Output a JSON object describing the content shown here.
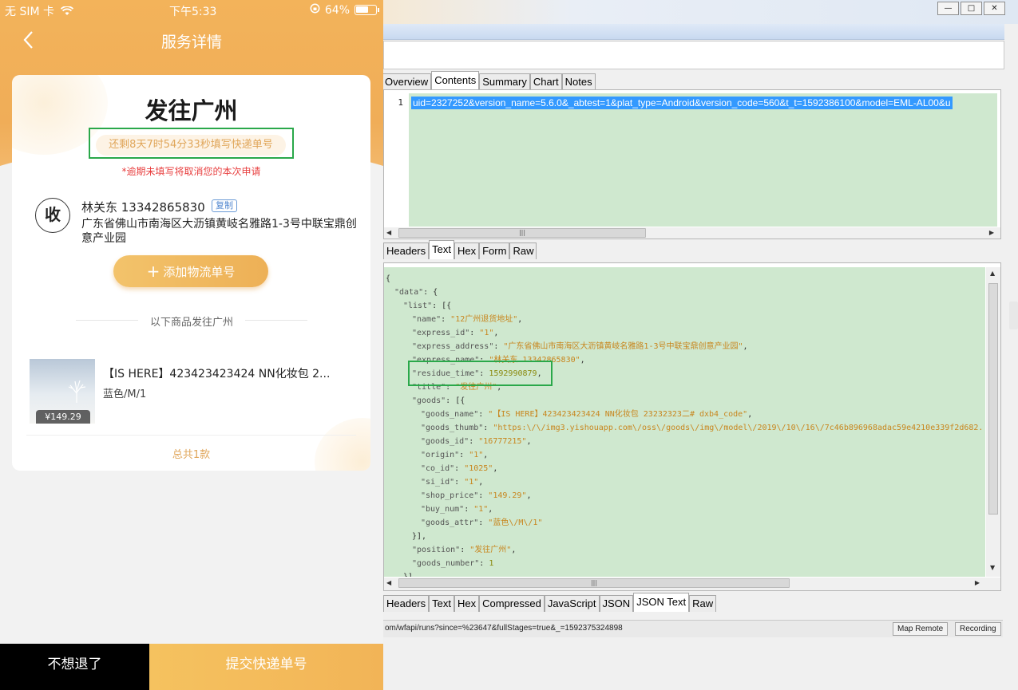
{
  "phone": {
    "status_bar": {
      "carrier": "无 SIM 卡",
      "time": "下午5:33",
      "battery": "64%",
      "battery_level": 0.64
    },
    "nav": {
      "title": "服务详情",
      "back_icon": "chevron-left-icon"
    },
    "card": {
      "destination_title": "发往广州",
      "countdown": "还剩8天7时54分33秒填写快递单号",
      "warning": "*逾期未填写将取消您的本次申请",
      "receiver_badge": "收",
      "receiver_name_phone": "林关东 13342865830",
      "copy_label": "复制",
      "receiver_address": "广东省佛山市南海区大沥镇黄岐名雅路1-3号中联宝鼎创意产业园",
      "add_tracking_label": "添加物流单号",
      "divider_text": "以下商品发往广州",
      "product": {
        "price": "¥149.29",
        "name": "【IS HERE】423423423424 NN化妆包 2...",
        "spec": "蓝色/M/1"
      },
      "total": "总共1款"
    },
    "footer": {
      "cancel_label": "不想退了",
      "submit_label": "提交快递单号"
    }
  },
  "desktop": {
    "window_controls": [
      "—",
      "□",
      "✕"
    ],
    "top_tabs": [
      "Overview",
      "Contents",
      "Summary",
      "Chart",
      "Notes"
    ],
    "active_top_tab": "Contents",
    "request_line_number": "1",
    "request_text": "uid=2327252&version_name=5.6.0&_abtest=1&plat_type=Android&version_code=560&t_t=1592386100&model=EML-AL00&u",
    "request_tabs": [
      "Headers",
      "Text",
      "Hex",
      "Form",
      "Raw"
    ],
    "active_request_tab": "Text",
    "response_tabs": [
      "Headers",
      "Text",
      "Hex",
      "Compressed",
      "JavaScript",
      "JSON",
      "JSON Text",
      "Raw"
    ],
    "active_response_tab": "JSON Text",
    "json_lines": [
      {
        "indent": 0,
        "parts": [
          {
            "t": "{",
            "c": "p"
          }
        ]
      },
      {
        "indent": 1,
        "parts": [
          {
            "t": "\"data\"",
            "c": "k"
          },
          {
            "t": ": {",
            "c": "p"
          }
        ]
      },
      {
        "indent": 2,
        "parts": [
          {
            "t": "\"list\"",
            "c": "k"
          },
          {
            "t": ": [{",
            "c": "p"
          }
        ]
      },
      {
        "indent": 3,
        "parts": [
          {
            "t": "\"name\"",
            "c": "k"
          },
          {
            "t": ": ",
            "c": "p"
          },
          {
            "t": "\"12广州退货地址\"",
            "c": "s"
          },
          {
            "t": ",",
            "c": "p"
          }
        ]
      },
      {
        "indent": 3,
        "parts": [
          {
            "t": "\"express_id\"",
            "c": "k"
          },
          {
            "t": ": ",
            "c": "p"
          },
          {
            "t": "\"1\"",
            "c": "s"
          },
          {
            "t": ",",
            "c": "p"
          }
        ]
      },
      {
        "indent": 3,
        "parts": [
          {
            "t": "\"express_address\"",
            "c": "k"
          },
          {
            "t": ": ",
            "c": "p"
          },
          {
            "t": "\"广东省佛山市南海区大沥镇黄岐名雅路1-3号中联宝鼎创意产业园\"",
            "c": "s"
          },
          {
            "t": ",",
            "c": "p"
          }
        ]
      },
      {
        "indent": 3,
        "parts": [
          {
            "t": "\"express_name\"",
            "c": "k"
          },
          {
            "t": ": ",
            "c": "p"
          },
          {
            "t": "\"林关东 13342865830\"",
            "c": "s"
          },
          {
            "t": ",",
            "c": "p"
          }
        ]
      },
      {
        "indent": 3,
        "parts": [
          {
            "t": "\"residue_time\"",
            "c": "k"
          },
          {
            "t": ": ",
            "c": "p"
          },
          {
            "t": "1592990879",
            "c": "n"
          },
          {
            "t": ",",
            "c": "p"
          }
        ]
      },
      {
        "indent": 3,
        "parts": [
          {
            "t": "\"title\"",
            "c": "k"
          },
          {
            "t": ": ",
            "c": "p"
          },
          {
            "t": "\"发往广州\"",
            "c": "s"
          },
          {
            "t": ",",
            "c": "p"
          }
        ]
      },
      {
        "indent": 3,
        "parts": [
          {
            "t": "\"goods\"",
            "c": "k"
          },
          {
            "t": ": [{",
            "c": "p"
          }
        ]
      },
      {
        "indent": 4,
        "parts": [
          {
            "t": "\"goods_name\"",
            "c": "k"
          },
          {
            "t": ": ",
            "c": "p"
          },
          {
            "t": "\"【IS HERE】423423423424 NN化妆包 23232323二# dxb4_code\"",
            "c": "s"
          },
          {
            "t": ",",
            "c": "p"
          }
        ]
      },
      {
        "indent": 4,
        "parts": [
          {
            "t": "\"goods_thumb\"",
            "c": "k"
          },
          {
            "t": ": ",
            "c": "p"
          },
          {
            "t": "\"https:\\/\\/img3.yishouapp.com\\/oss\\/goods\\/img\\/model\\/2019\\/10\\/16\\/7c46b896968adac59e4210e339f2d682.",
            "c": "s"
          }
        ]
      },
      {
        "indent": 4,
        "parts": [
          {
            "t": "\"goods_id\"",
            "c": "k"
          },
          {
            "t": ": ",
            "c": "p"
          },
          {
            "t": "\"16777215\"",
            "c": "s"
          },
          {
            "t": ",",
            "c": "p"
          }
        ]
      },
      {
        "indent": 4,
        "parts": [
          {
            "t": "\"origin\"",
            "c": "k"
          },
          {
            "t": ": ",
            "c": "p"
          },
          {
            "t": "\"1\"",
            "c": "s"
          },
          {
            "t": ",",
            "c": "p"
          }
        ]
      },
      {
        "indent": 4,
        "parts": [
          {
            "t": "\"co_id\"",
            "c": "k"
          },
          {
            "t": ": ",
            "c": "p"
          },
          {
            "t": "\"1025\"",
            "c": "s"
          },
          {
            "t": ",",
            "c": "p"
          }
        ]
      },
      {
        "indent": 4,
        "parts": [
          {
            "t": "\"si_id\"",
            "c": "k"
          },
          {
            "t": ": ",
            "c": "p"
          },
          {
            "t": "\"1\"",
            "c": "s"
          },
          {
            "t": ",",
            "c": "p"
          }
        ]
      },
      {
        "indent": 4,
        "parts": [
          {
            "t": "\"shop_price\"",
            "c": "k"
          },
          {
            "t": ": ",
            "c": "p"
          },
          {
            "t": "\"149.29\"",
            "c": "s"
          },
          {
            "t": ",",
            "c": "p"
          }
        ]
      },
      {
        "indent": 4,
        "parts": [
          {
            "t": "\"buy_num\"",
            "c": "k"
          },
          {
            "t": ": ",
            "c": "p"
          },
          {
            "t": "\"1\"",
            "c": "s"
          },
          {
            "t": ",",
            "c": "p"
          }
        ]
      },
      {
        "indent": 4,
        "parts": [
          {
            "t": "\"goods_attr\"",
            "c": "k"
          },
          {
            "t": ": ",
            "c": "p"
          },
          {
            "t": "\"蓝色\\/M\\/1\"",
            "c": "s"
          }
        ]
      },
      {
        "indent": 3,
        "parts": [
          {
            "t": "}],",
            "c": "p"
          }
        ]
      },
      {
        "indent": 3,
        "parts": [
          {
            "t": "\"position\"",
            "c": "k"
          },
          {
            "t": ": ",
            "c": "p"
          },
          {
            "t": "\"发往广州\"",
            "c": "s"
          },
          {
            "t": ",",
            "c": "p"
          }
        ]
      },
      {
        "indent": 3,
        "parts": [
          {
            "t": "\"goods_number\"",
            "c": "k"
          },
          {
            "t": ": ",
            "c": "p"
          },
          {
            "t": "1",
            "c": "n"
          }
        ]
      },
      {
        "indent": 2,
        "parts": [
          {
            "t": "}]",
            "c": "p"
          }
        ]
      }
    ],
    "status_url": "om/wfapi/runs?since=%23647&fullStages=true&_=1592375324898",
    "status_buttons": [
      "Map Remote",
      "Recording"
    ],
    "colors": {
      "highlight_green": "#2aa84a",
      "json_bg": "#cfe8cf",
      "selection_blue": "#3399ff"
    }
  }
}
